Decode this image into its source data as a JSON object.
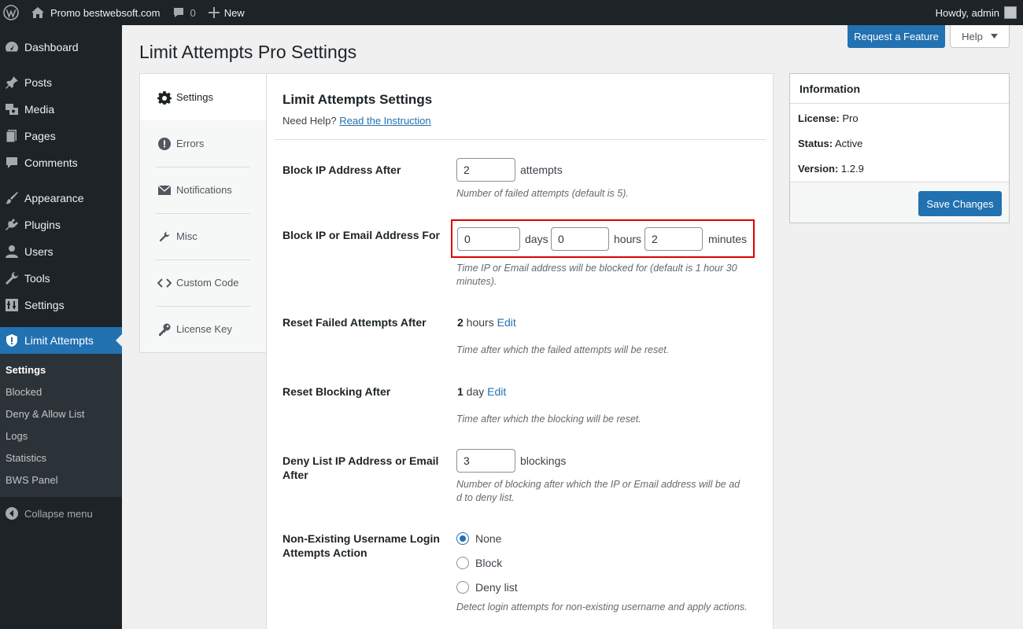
{
  "adminbar": {
    "site_name": "Promo bestwebsoft.com",
    "comments_count": "0",
    "new_label": "New",
    "howdy": "Howdy, admin"
  },
  "sidebar": {
    "items": [
      {
        "label": "Dashboard",
        "icon": "dashboard-icon"
      },
      {
        "label": "Posts",
        "icon": "pin-icon"
      },
      {
        "label": "Media",
        "icon": "media-icon"
      },
      {
        "label": "Pages",
        "icon": "pages-icon"
      },
      {
        "label": "Comments",
        "icon": "comment-icon"
      },
      {
        "label": "Appearance",
        "icon": "brush-icon"
      },
      {
        "label": "Plugins",
        "icon": "plug-icon"
      },
      {
        "label": "Users",
        "icon": "user-icon"
      },
      {
        "label": "Tools",
        "icon": "wrench-icon"
      },
      {
        "label": "Settings",
        "icon": "settings-icon"
      },
      {
        "label": "Limit Attempts",
        "icon": "shield-icon"
      }
    ],
    "submenu": [
      "Settings",
      "Blocked",
      "Deny & Allow List",
      "Logs",
      "Statistics",
      "BWS Panel"
    ],
    "collapse_label": "Collapse menu"
  },
  "header": {
    "request_feature": "Request a Feature",
    "help": "Help",
    "page_title": "Limit Attempts Pro Settings"
  },
  "tabs": [
    {
      "label": "Settings",
      "icon": "gear-icon"
    },
    {
      "label": "Errors",
      "icon": "error-icon"
    },
    {
      "label": "Notifications",
      "icon": "envelope-icon"
    },
    {
      "label": "Misc",
      "icon": "wrench-icon"
    },
    {
      "label": "Custom Code",
      "icon": "code-icon"
    },
    {
      "label": "License Key",
      "icon": "key-icon"
    }
  ],
  "panel": {
    "title": "Limit Attempts Settings",
    "need_help": "Need Help?",
    "read_instruction": "Read the Instruction",
    "block_ip_after": {
      "label": "Block IP Address After",
      "value": "2",
      "unit": "attempts",
      "desc": "Number of failed attempts (default is 5)."
    },
    "block_for": {
      "label": "Block IP or Email Address For",
      "days_value": "0",
      "days_unit": "days",
      "hours_value": "0",
      "hours_unit": "hours",
      "minutes_value": "2",
      "minutes_unit": "minutes",
      "desc": "Time IP or Email address will be blocked for (default is 1 hour 30 minutes)."
    },
    "reset_failed": {
      "label": "Reset Failed Attempts After",
      "number": "2",
      "unit": " hours ",
      "edit": "Edit",
      "desc": "Time after which the failed attempts will be reset."
    },
    "reset_blocking": {
      "label": "Reset Blocking After",
      "number": "1",
      "unit": " day ",
      "edit": "Edit",
      "desc": "Time after which the blocking will be reset."
    },
    "deny_list": {
      "label": "Deny List IP Address or Email After",
      "value": "3",
      "unit": "blockings",
      "desc": "Number of blocking after which the IP or Email address will be ad d to deny list."
    },
    "non_existing": {
      "label": "Non-Existing Username Login Attempts Action",
      "options": [
        "None",
        "Block",
        "Deny list"
      ],
      "selected": "None",
      "desc": "Detect login attempts for non-existing username and apply actions."
    }
  },
  "info": {
    "title": "Information",
    "license_key": "License:",
    "license_value": "Pro",
    "status_key": "Status:",
    "status_value": "Active",
    "version_key": "Version:",
    "version_value": "1.2.9",
    "save_button": "Save Changes"
  },
  "colors": {
    "primary": "#2271b1",
    "adminbar": "#1d2327",
    "highlight": "#e00000"
  }
}
